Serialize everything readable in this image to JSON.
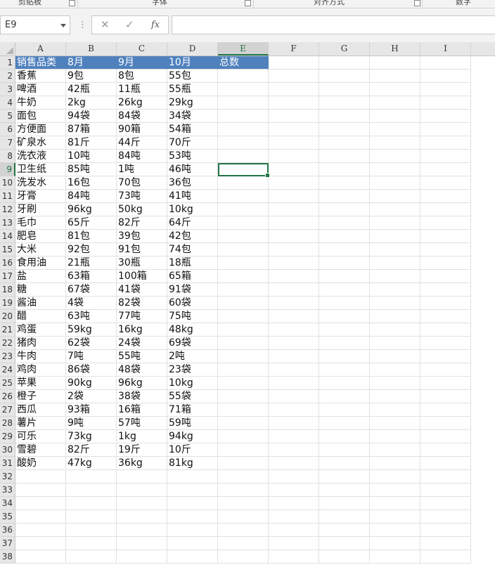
{
  "ribbon": {
    "groups": [
      "剪贴板",
      "字体",
      "对齐方式",
      "数字"
    ]
  },
  "formula_bar": {
    "name_box": "E9",
    "cancel_icon": "✕",
    "confirm_icon": "✓",
    "fx_label": "fx",
    "formula_value": ""
  },
  "sheet": {
    "columns": [
      "A",
      "B",
      "C",
      "D",
      "E",
      "F",
      "G",
      "H",
      "I"
    ],
    "selected_column": "E",
    "selected_row": 9,
    "active_cell": "E9",
    "header_fill_color": "#4f81bd",
    "rows": [
      [
        "销售品类",
        "8月",
        "9月",
        "10月",
        "总数"
      ],
      [
        "香蕉",
        "9包",
        "8包",
        "55包",
        ""
      ],
      [
        "啤酒",
        "42瓶",
        "11瓶",
        "55瓶",
        ""
      ],
      [
        "牛奶",
        "2kg",
        "26kg",
        "29kg",
        ""
      ],
      [
        "面包",
        "94袋",
        "84袋",
        "34袋",
        ""
      ],
      [
        "方便面",
        "87箱",
        "90箱",
        "54箱",
        ""
      ],
      [
        "矿泉水",
        "81斤",
        "44斤",
        "70斤",
        ""
      ],
      [
        "洗衣液",
        "10吨",
        "84吨",
        "53吨",
        ""
      ],
      [
        "卫生纸",
        "85吨",
        "1吨",
        "46吨",
        ""
      ],
      [
        "洗发水",
        "16包",
        "70包",
        "36包",
        ""
      ],
      [
        "牙膏",
        "84吨",
        "73吨",
        "41吨",
        ""
      ],
      [
        "牙刷",
        "96kg",
        "50kg",
        "10kg",
        ""
      ],
      [
        "毛巾",
        "65斤",
        "82斤",
        "64斤",
        ""
      ],
      [
        "肥皂",
        "81包",
        "39包",
        "42包",
        ""
      ],
      [
        "大米",
        "92包",
        "91包",
        "74包",
        ""
      ],
      [
        "食用油",
        "21瓶",
        "30瓶",
        "18瓶",
        ""
      ],
      [
        "盐",
        "63箱",
        "100箱",
        "65箱",
        ""
      ],
      [
        "糖",
        "67袋",
        "41袋",
        "91袋",
        ""
      ],
      [
        "酱油",
        "4袋",
        "82袋",
        "60袋",
        ""
      ],
      [
        "醋",
        "63吨",
        "77吨",
        "75吨",
        ""
      ],
      [
        "鸡蛋",
        "59kg",
        "16kg",
        "48kg",
        ""
      ],
      [
        "猪肉",
        "62袋",
        "24袋",
        "69袋",
        ""
      ],
      [
        "牛肉",
        "7吨",
        "55吨",
        "2吨",
        ""
      ],
      [
        "鸡肉",
        "86袋",
        "48袋",
        "23袋",
        ""
      ],
      [
        "苹果",
        "90kg",
        "96kg",
        "10kg",
        ""
      ],
      [
        "橙子",
        "2袋",
        "38袋",
        "55袋",
        ""
      ],
      [
        "西瓜",
        "93箱",
        "16箱",
        "71箱",
        ""
      ],
      [
        "薯片",
        "9吨",
        "57吨",
        "59吨",
        ""
      ],
      [
        "可乐",
        "73kg",
        "1kg",
        "94kg",
        ""
      ],
      [
        "雪碧",
        "82斤",
        "19斤",
        "10斤",
        ""
      ],
      [
        "酸奶",
        "47kg",
        "36kg",
        "81kg",
        ""
      ],
      [
        "",
        "",
        "",
        "",
        ""
      ],
      [
        "",
        "",
        "",
        "",
        ""
      ],
      [
        "",
        "",
        "",
        "",
        ""
      ],
      [
        "",
        "",
        "",
        "",
        ""
      ],
      [
        "",
        "",
        "",
        "",
        ""
      ],
      [
        "",
        "",
        "",
        "",
        ""
      ],
      [
        "",
        "",
        "",
        "",
        ""
      ]
    ]
  }
}
